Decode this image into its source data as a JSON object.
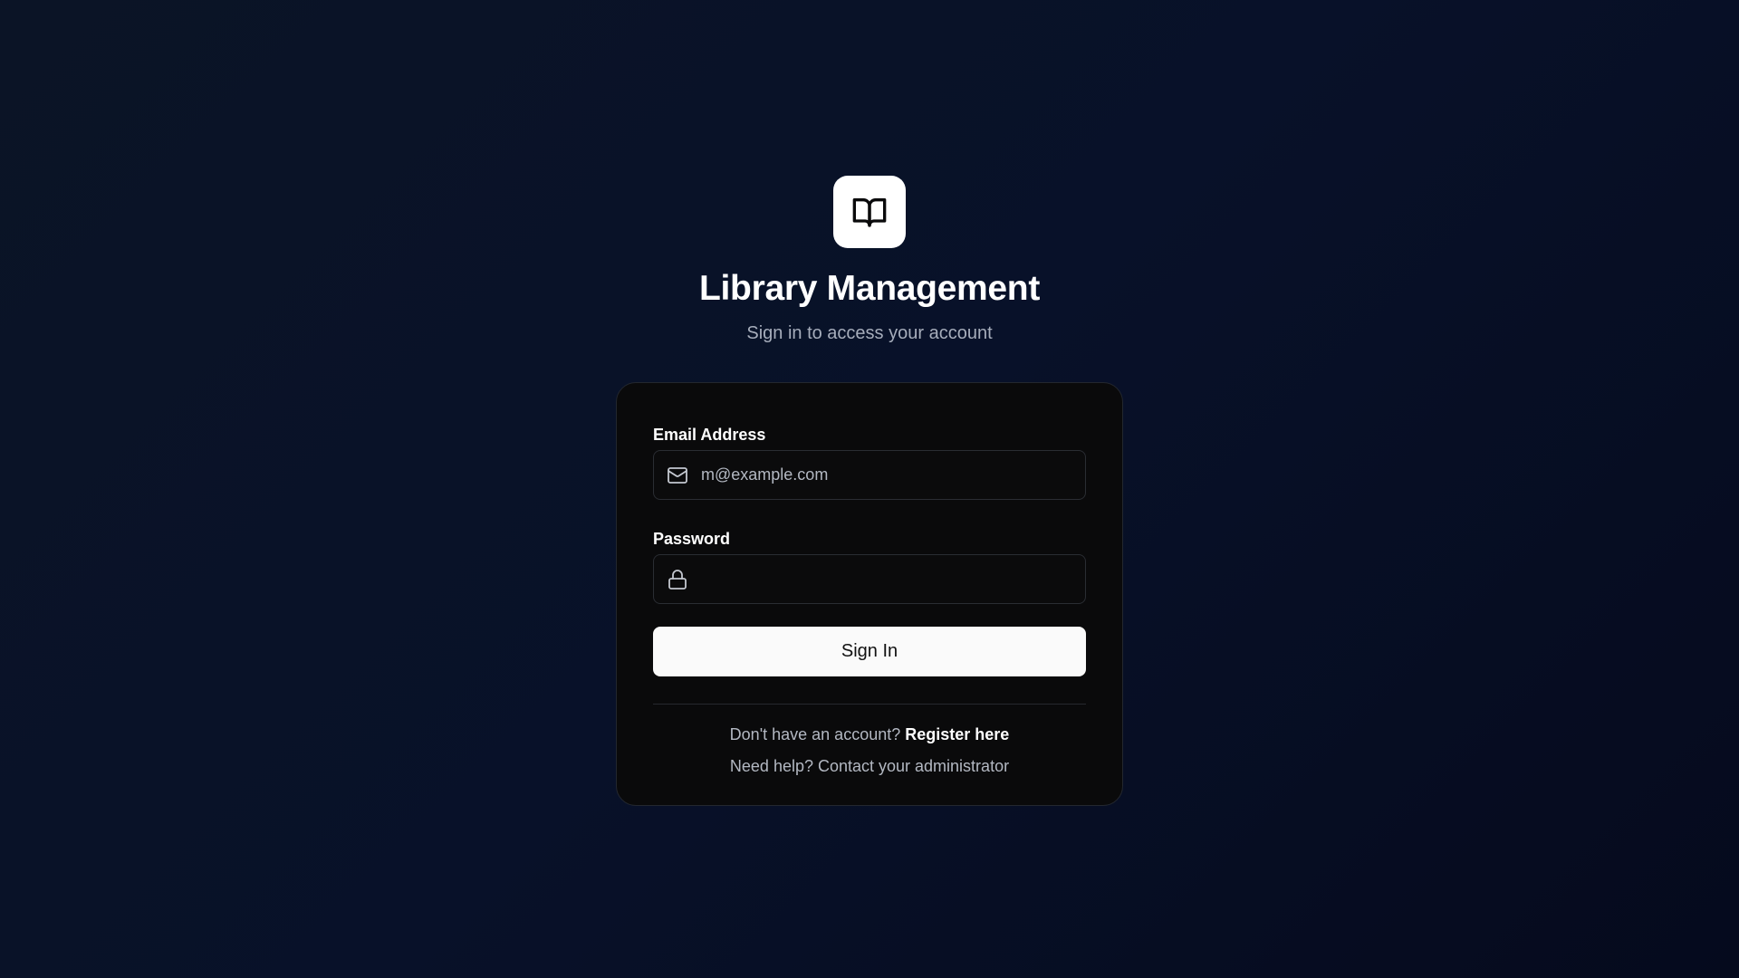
{
  "header": {
    "logo_icon": "book-open-icon",
    "title": "Library Management",
    "subtitle": "Sign in to access your account"
  },
  "form": {
    "email": {
      "label": "Email Address",
      "icon": "mail-icon",
      "placeholder": "m@example.com",
      "value": ""
    },
    "password": {
      "label": "Password",
      "icon": "lock-icon",
      "placeholder": "",
      "value": ""
    },
    "submit_label": "Sign In"
  },
  "footer": {
    "register_prompt": "Don't have an account?",
    "register_link": "Register here",
    "help_text": "Need help? Contact your administrator"
  },
  "colors": {
    "background": "#0b1426",
    "card": "#0a0a0b",
    "button": "#fafafa",
    "muted_text": "#a6adbb"
  }
}
